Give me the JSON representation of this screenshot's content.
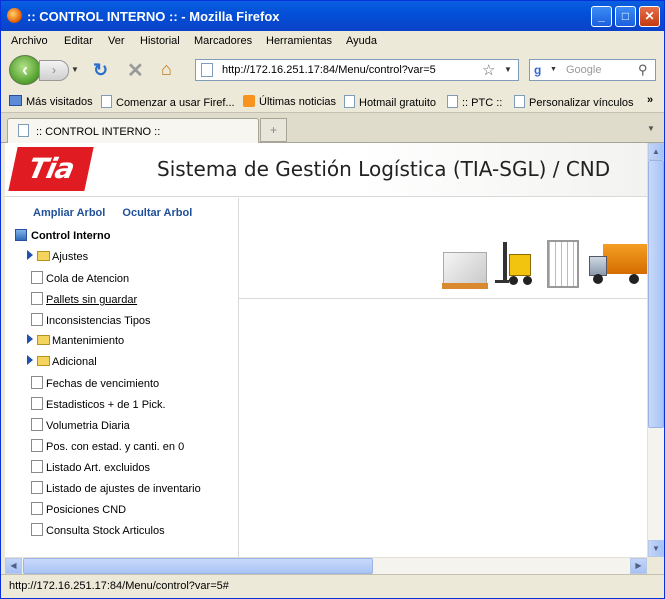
{
  "window": {
    "title": ":: CONTROL INTERNO :: - Mozilla Firefox",
    "min_icon": "_",
    "max_icon": "□",
    "close_icon": "✕"
  },
  "menu": [
    "Archivo",
    "Editar",
    "Ver",
    "Historial",
    "Marcadores",
    "Herramientas",
    "Ayuda"
  ],
  "nav": {
    "url": "http://172.16.251.17:84/Menu/control?var=5",
    "search_placeholder": "Google"
  },
  "bookmarks": [
    "Más visitados",
    "Comenzar a usar Firef...",
    "Últimas noticias",
    "Hotmail gratuito",
    ":: PTC ::",
    "Personalizar vínculos"
  ],
  "bookmarks_more": "»",
  "tab": {
    "label": ":: CONTROL INTERNO ::",
    "new_tab": "+"
  },
  "header": {
    "logo": "Tia",
    "title": "Sistema de Gestión Logística (TIA-SGL) / CND"
  },
  "tree": {
    "expand_link": "Ampliar Arbol",
    "hide_link": "Ocultar Arbol",
    "root": "Control Interno",
    "items": [
      {
        "label": "Ajustes",
        "type": "folder"
      },
      {
        "label": "Cola de Atencion",
        "type": "doc"
      },
      {
        "label": "Pallets sin guardar",
        "type": "doc"
      },
      {
        "label": "Inconsistencias Tipos",
        "type": "doc"
      },
      {
        "label": "Mantenimiento",
        "type": "folder"
      },
      {
        "label": "Adicional",
        "type": "folder"
      },
      {
        "label": "Fechas de vencimiento",
        "type": "doc"
      },
      {
        "label": "Estadisticos + de 1 Pick.",
        "type": "doc"
      },
      {
        "label": "Volumetria Diaria",
        "type": "doc"
      },
      {
        "label": "Pos. con estad. y canti. en 0",
        "type": "doc"
      },
      {
        "label": "Listado Art. excluidos",
        "type": "doc"
      },
      {
        "label": "Listado de ajustes de inventario",
        "type": "doc"
      },
      {
        "label": "Posiciones CND",
        "type": "doc"
      },
      {
        "label": "Consulta Stock Articulos",
        "type": "doc"
      }
    ]
  },
  "status": {
    "text": "http://172.16.251.17:84/Menu/control?var=5#"
  },
  "colors": {
    "brand_red": "#e11b22",
    "link_blue": "#1f4f99",
    "titlebar_blue": "#0a5fe0"
  }
}
